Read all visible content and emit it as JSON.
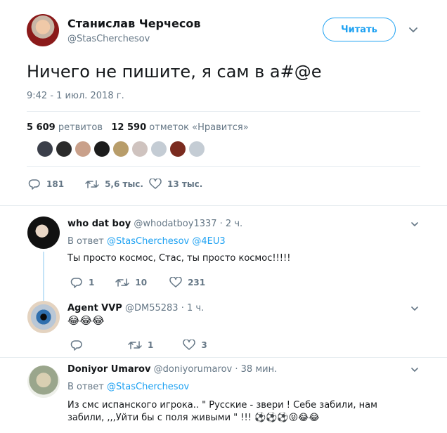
{
  "main_tweet": {
    "author_name": "Станислав Черчесов",
    "author_handle": "@StasCherchesov",
    "follow_label": "Читать",
    "text": "Ничего не пишите, я сам в а#@е",
    "timestamp": "9:42 - 1 июл. 2018 г.",
    "retweets_count": "5 609",
    "retweets_label": "ретвитов",
    "likes_count": "12 590",
    "likes_label": "отметок «Нравится»",
    "reply_count": "181",
    "retweet_action_count": "5,6 тыс.",
    "like_action_count": "13 тыс."
  },
  "replies": [
    {
      "name": "who dat boy",
      "handle": "@whodatboy1337",
      "time": "· 2 ч.",
      "reply_prefix": "В ответ",
      "reply_to": "@StasCherchesov @4EU3",
      "text": "Ты просто космос, Стас, ты просто космос!!!!!",
      "replies": "1",
      "retweets": "10",
      "likes": "231"
    },
    {
      "name": "Agent VVP",
      "handle": "@DM55283",
      "time": "· 1 ч.",
      "text": "😂😂😂",
      "replies": "",
      "retweets": "1",
      "likes": "3"
    },
    {
      "name": "Doniyor Umarov",
      "handle": "@doniyorumarov",
      "time": "· 38 мин.",
      "reply_prefix": "В ответ",
      "reply_to": "@StasCherchesov",
      "text": "Из смс испанского игрока.. \" Русские - звери ! Себе забили, нам забили, ,,,Уйти бы с поля живыми \" !!! ⚽⚽⚽😝😂😂"
    }
  ],
  "colors": {
    "accent": "#1da1f2",
    "text": "#14171a",
    "muted": "#657786",
    "divider": "#e6ecf0"
  },
  "icons": [
    "reply-icon",
    "retweet-icon",
    "heart-icon",
    "chevron-down-icon"
  ]
}
